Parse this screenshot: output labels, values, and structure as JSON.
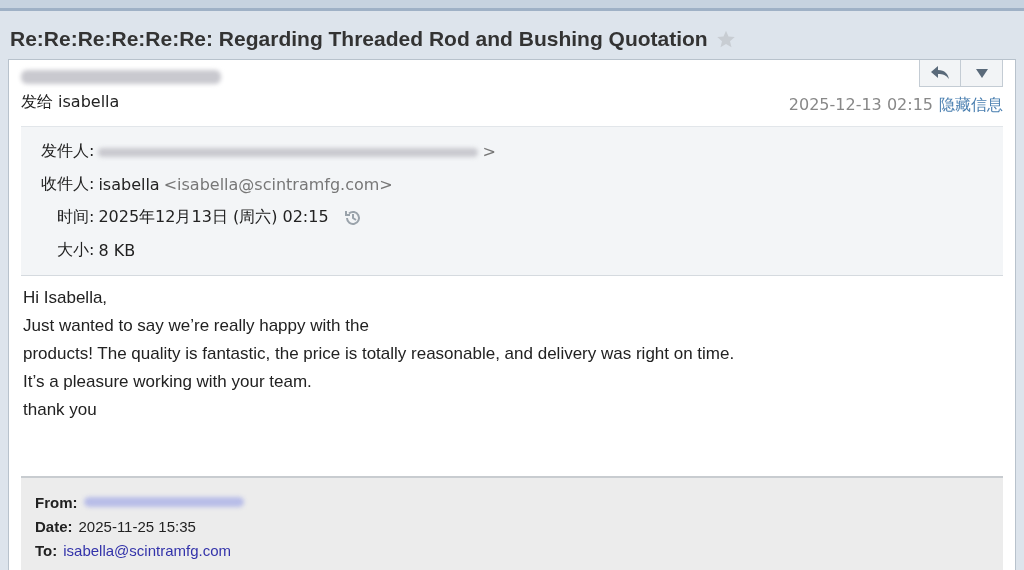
{
  "subject": "Re:Re:Re:Re:Re:Re: Regarding Threaded Rod and Bushing Quotation",
  "starred": false,
  "header": {
    "recipient_line": "发给 isabella",
    "datetime": "2025-12-13 02:15",
    "toggle_link": "隐藏信息"
  },
  "details": [
    {
      "kind": "blurred",
      "label": "发件人:",
      "tail": ">"
    },
    {
      "kind": "address",
      "label": "收件人:",
      "name": "isabella",
      "address": "<isabella@scintramfg.com>"
    },
    {
      "kind": "time",
      "label": "时间:",
      "value": "2025年12月13日 (周六) 02:15"
    },
    {
      "kind": "plain",
      "label": "大小:",
      "value": "8 KB"
    }
  ],
  "body": [
    "Hi Isabella,",
    "Just wanted to say we’re really happy with the",
    "products! The quality is fantastic, the price is totally reasonable, and delivery was right on time.",
    "It’s a pleasure working with your team.",
    "thank you"
  ],
  "quoted": [
    {
      "kind": "blurred",
      "label": "From:"
    },
    {
      "kind": "plain",
      "label": "Date:",
      "value": "2025-11-25 15:35"
    },
    {
      "kind": "link",
      "label": "To:",
      "value": "isabella@scintramfg.com"
    }
  ]
}
